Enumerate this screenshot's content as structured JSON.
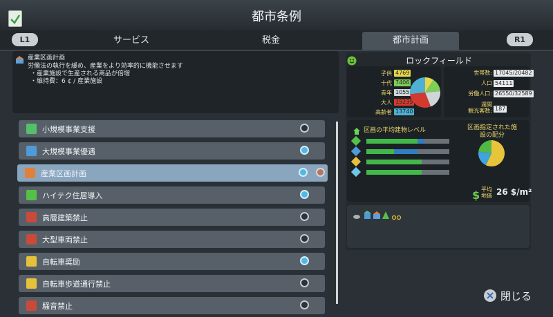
{
  "window": {
    "title": "都市条例"
  },
  "tabs": {
    "left_bumper": "L1",
    "right_bumper": "R1",
    "items": [
      {
        "label": "サービス"
      },
      {
        "label": "税金"
      },
      {
        "label": "都市計画"
      }
    ],
    "active": "都市計画"
  },
  "info": {
    "title": "産業区画計画",
    "description": "労働法の執行を緩め、産業をより効率的に機能させます",
    "bullet1": "・産業施設で生産される商品が倍増",
    "bullet2": "・維持費：6 ¢ / 産業施設"
  },
  "policies": [
    {
      "label": "小規模事業支援",
      "icon": "small-business-icon",
      "enabled": false
    },
    {
      "label": "大規模事業優遇",
      "icon": "big-business-icon",
      "enabled": true
    },
    {
      "label": "産業区画計画",
      "icon": "industry-space-planning-icon",
      "enabled": true,
      "selected": true
    },
    {
      "label": "ハイテク住居導入",
      "icon": "hightech-housing-icon",
      "enabled": true
    },
    {
      "label": "高層建築禁止",
      "icon": "high-rise-ban-icon",
      "enabled": false
    },
    {
      "label": "大型車両禁止",
      "icon": "heavy-traffic-ban-icon",
      "enabled": false
    },
    {
      "label": "自転車奨励",
      "icon": "bike-icon",
      "enabled": true
    },
    {
      "label": "自転車歩道通行禁止",
      "icon": "bike-ban-sidewalk-icon",
      "enabled": false
    },
    {
      "label": "騒音禁止",
      "icon": "noise-ban-icon",
      "enabled": false
    }
  ],
  "district": {
    "name": "ロックフィールド",
    "age_groups": [
      {
        "label": "子供",
        "value": "4769",
        "color": "#e6d84a"
      },
      {
        "label": "十代",
        "value": "7406",
        "color": "#7fcf57"
      },
      {
        "label": "青年",
        "value": "10558",
        "color": "#cfd6da"
      },
      {
        "label": "大人",
        "value": "15235",
        "color": "#d23a2f"
      },
      {
        "label": "高齢者",
        "value": "13740",
        "color": "#4fb0d3"
      }
    ],
    "stats": [
      {
        "label": "世帯数:",
        "value": "17045/20482"
      },
      {
        "label": "人口",
        "value": "54111"
      },
      {
        "label": "労働人口:",
        "value": "26550/32589"
      },
      {
        "label": "週間\n観光客数:",
        "value": "187"
      }
    ],
    "building_level_title": "区画の平均建物レベル",
    "levels": [
      {
        "green": 0.62,
        "blue": 0.08
      },
      {
        "green": 0.33,
        "blue": 0.29
      },
      {
        "green": 0.67,
        "blue": 0
      },
      {
        "green": 0.67,
        "blue": 0
      }
    ],
    "zone_distribution_title": "区画指定された施設の配分",
    "avg_land_value_label": "平均\n地価",
    "avg_land_value": "26 $/m²",
    "pie_age": [
      4769,
      7406,
      10558,
      15235,
      13740
    ],
    "pie_zone": [
      {
        "value": 0.57,
        "color": "#e8c43a"
      },
      {
        "value": 0.2,
        "color": "#3fa3df"
      },
      {
        "value": 0.23,
        "color": "#52b848"
      }
    ]
  },
  "footer": {
    "close_label": "閉じる"
  }
}
